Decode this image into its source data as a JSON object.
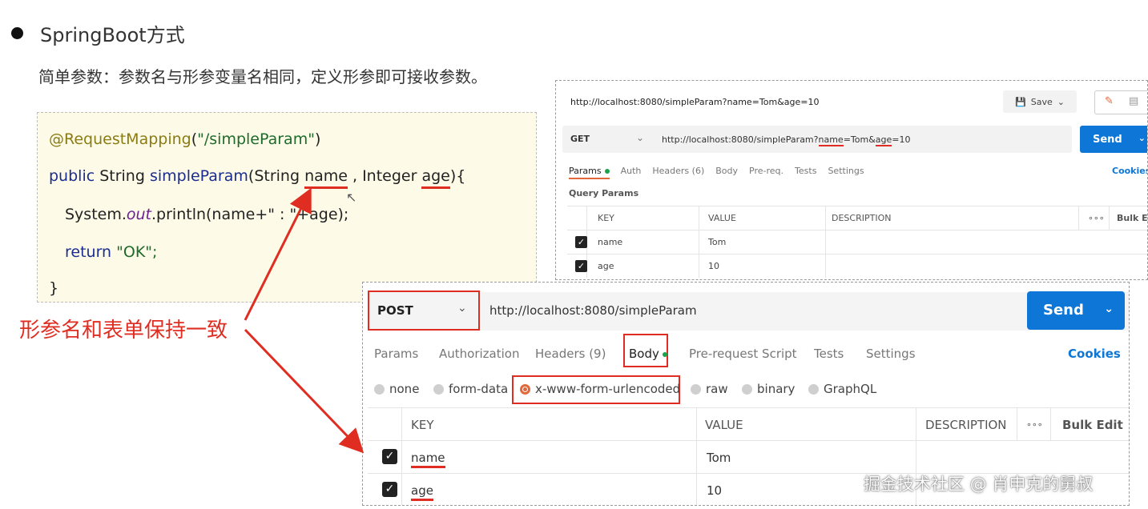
{
  "heading": "SpringBoot方式",
  "subtitle": "简单参数：参数名与形参变量名相同，定义形参即可接收参数。",
  "code": {
    "annotation": "@RequestMapping",
    "annotation_arg_open": "(",
    "annotation_arg": "\"/simpleParam\"",
    "annotation_arg_close": ")",
    "sig_public": "public",
    "sig_string": " String ",
    "sig_method": "simpleParam",
    "sig_open": "(String ",
    "sig_param1": "name",
    "sig_mid": " , Integer ",
    "sig_param2": "age",
    "sig_close": "){",
    "print_prefix": "System.",
    "print_field": "out",
    "print_rest_a": ".println(name+\"",
    "print_colon": " : ",
    "print_rest_b": "\"+age);",
    "return_kw": "return",
    "return_val": " \"OK\";",
    "close_brace": "}"
  },
  "annotation_label": "形参名和表单保持一致",
  "postman_get": {
    "title_url": "http://localhost:8080/simpleParam?name=Tom&age=10",
    "save_label": "Save",
    "method": "GET",
    "url_prefix": "http://localhost:8080/simpleParam?",
    "url_name": "name",
    "url_mid": "=Tom&",
    "url_age": "age",
    "url_suffix": "=10",
    "send_label": "Send",
    "tabs": [
      "Params",
      "Auth",
      "Headers (6)",
      "Body",
      "Pre-req.",
      "Tests",
      "Settings"
    ],
    "cookies_label": "Cookies",
    "query_params_label": "Query Params",
    "columns": [
      "KEY",
      "VALUE",
      "DESCRIPTION",
      "Bulk Ed"
    ],
    "more_label": "∘∘∘",
    "rows": [
      {
        "key": "name",
        "value": "Tom"
      },
      {
        "key": "age",
        "value": "10"
      }
    ]
  },
  "postman_post": {
    "method": "POST",
    "url": "http://localhost:8080/simpleParam",
    "send_label": "Send",
    "tabs": [
      "Params",
      "Authorization",
      "Headers (9)",
      "Body",
      "Pre-request Script",
      "Tests",
      "Settings"
    ],
    "cookies_label": "Cookies",
    "body_types": [
      "none",
      "form-data",
      "x-www-form-urlencoded",
      "raw",
      "binary",
      "GraphQL"
    ],
    "selected_body_type": "x-www-form-urlencoded",
    "columns": [
      "KEY",
      "VALUE",
      "DESCRIPTION",
      "Bulk Edit"
    ],
    "more_label": "∘∘∘",
    "rows": [
      {
        "key": "name",
        "value": "Tom"
      },
      {
        "key": "age",
        "value": "10"
      }
    ]
  },
  "watermark": "掘金技术社区 @ 肖申克的舅叔",
  "colors": {
    "accent_red": "#e02d22",
    "postman_blue": "#0e76d6",
    "postman_orange": "#e2683c",
    "code_bg": "#fdfbe7"
  }
}
